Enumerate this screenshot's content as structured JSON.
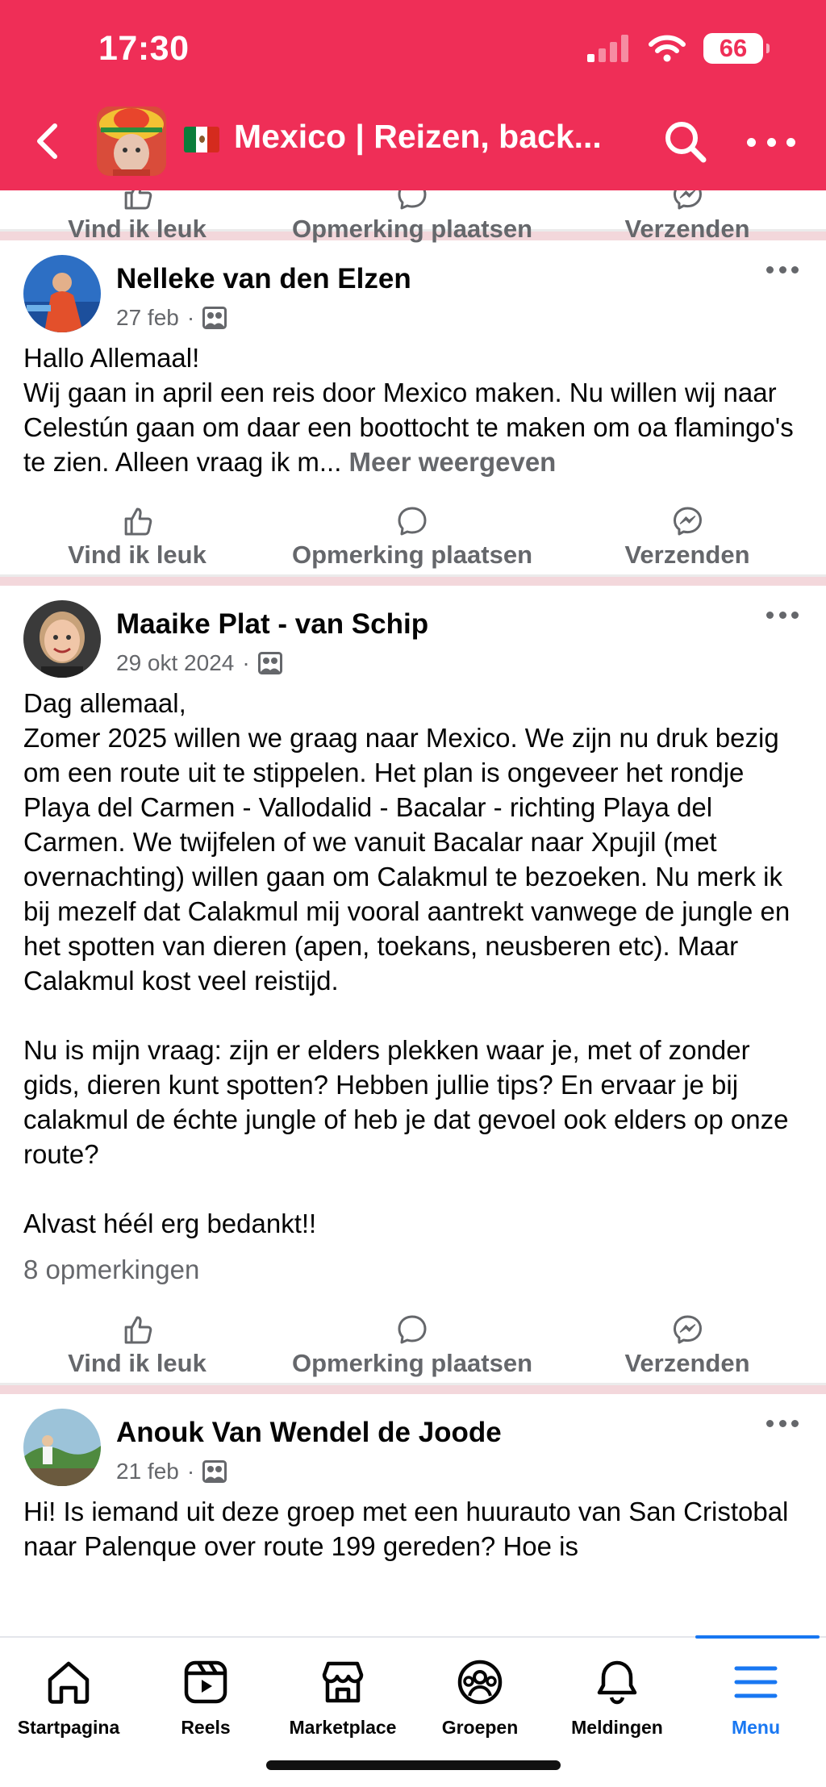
{
  "status_bar": {
    "time": "17:30",
    "battery": "66"
  },
  "header": {
    "title": "Mexico | Reizen, back...",
    "icons": {
      "back": "chevron-left-icon",
      "search": "search-icon",
      "more": "more-dots-icon",
      "flag": "mexico-flag-icon"
    }
  },
  "actions": {
    "like": "Vind ik leuk",
    "comment": "Opmerking plaatsen",
    "send": "Verzenden"
  },
  "posts": [
    {
      "author": "Nelleke van den Elzen",
      "date": "27 feb",
      "dot": "·",
      "body": "Hallo Allemaal!\nWij gaan in april een reis door Mexico maken. Nu willen wij naar Celestún gaan om daar een boottocht te maken om oa flamingo's te zien. Alleen vraag ik m...",
      "see_more": " Meer weergeven"
    },
    {
      "author": "Maaike Plat - van Schip",
      "date": "29 okt 2024",
      "dot": "·",
      "body": "Dag allemaal,\nZomer 2025 willen we graag naar Mexico. We zijn nu druk bezig om een route uit te stippelen. Het plan is ongeveer het rondje Playa del Carmen - Vallodalid - Bacalar - richting Playa del Carmen. We twijfelen of we vanuit Bacalar naar Xpujil (met overnachting) willen gaan om Calakmul te bezoeken. Nu merk ik bij mezelf dat Calakmul mij vooral aantrekt vanwege de jungle en het spotten van dieren (apen, toekans, neusberen etc). Maar Calakmul kost veel reistijd.\n\nNu is mijn vraag: zijn er elders plekken waar je, met of zonder gids, dieren kunt spotten? Hebben jullie tips? En ervaar je bij calakmul de échte jungle of heb je dat gevoel ook elders op onze route?\n\nAlvast héél erg bedankt!!",
      "comments": "8 opmerkingen"
    },
    {
      "author": "Anouk Van Wendel de Joode",
      "date": "21 feb",
      "dot": "·",
      "body": "Hi! Is iemand uit deze groep met een huurauto van San Cristobal naar Palenque over route 199 gereden? Hoe is"
    }
  ],
  "tabs": [
    {
      "label": "Startpagina",
      "icon": "home-icon"
    },
    {
      "label": "Reels",
      "icon": "reels-icon"
    },
    {
      "label": "Marketplace",
      "icon": "marketplace-icon"
    },
    {
      "label": "Groepen",
      "icon": "groups-icon"
    },
    {
      "label": "Meldingen",
      "icon": "bell-icon"
    },
    {
      "label": "Menu",
      "icon": "menu-icon",
      "active": true
    }
  ],
  "colors": {
    "brand_header": "#ef2e57",
    "active_tab": "#1877f2",
    "secondary_text": "#65676b"
  }
}
